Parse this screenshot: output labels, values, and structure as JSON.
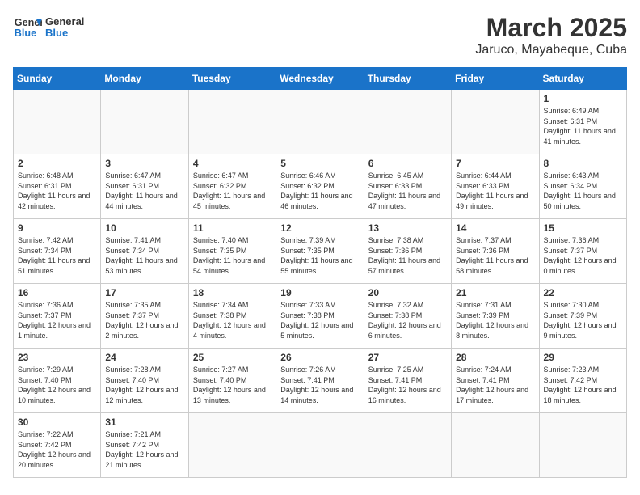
{
  "header": {
    "logo_line1": "General",
    "logo_line2": "Blue",
    "title": "March 2025",
    "subtitle": "Jaruco, Mayabeque, Cuba"
  },
  "days_of_week": [
    "Sunday",
    "Monday",
    "Tuesday",
    "Wednesday",
    "Thursday",
    "Friday",
    "Saturday"
  ],
  "weeks": [
    [
      {
        "day": "",
        "info": ""
      },
      {
        "day": "",
        "info": ""
      },
      {
        "day": "",
        "info": ""
      },
      {
        "day": "",
        "info": ""
      },
      {
        "day": "",
        "info": ""
      },
      {
        "day": "",
        "info": ""
      },
      {
        "day": "1",
        "info": "Sunrise: 6:49 AM\nSunset: 6:31 PM\nDaylight: 11 hours\nand 41 minutes."
      }
    ],
    [
      {
        "day": "2",
        "info": "Sunrise: 6:48 AM\nSunset: 6:31 PM\nDaylight: 11 hours\nand 42 minutes."
      },
      {
        "day": "3",
        "info": "Sunrise: 6:47 AM\nSunset: 6:31 PM\nDaylight: 11 hours\nand 44 minutes."
      },
      {
        "day": "4",
        "info": "Sunrise: 6:47 AM\nSunset: 6:32 PM\nDaylight: 11 hours\nand 45 minutes."
      },
      {
        "day": "5",
        "info": "Sunrise: 6:46 AM\nSunset: 6:32 PM\nDaylight: 11 hours\nand 46 minutes."
      },
      {
        "day": "6",
        "info": "Sunrise: 6:45 AM\nSunset: 6:33 PM\nDaylight: 11 hours\nand 47 minutes."
      },
      {
        "day": "7",
        "info": "Sunrise: 6:44 AM\nSunset: 6:33 PM\nDaylight: 11 hours\nand 49 minutes."
      },
      {
        "day": "8",
        "info": "Sunrise: 6:43 AM\nSunset: 6:34 PM\nDaylight: 11 hours\nand 50 minutes."
      }
    ],
    [
      {
        "day": "9",
        "info": "Sunrise: 7:42 AM\nSunset: 7:34 PM\nDaylight: 11 hours\nand 51 minutes."
      },
      {
        "day": "10",
        "info": "Sunrise: 7:41 AM\nSunset: 7:34 PM\nDaylight: 11 hours\nand 53 minutes."
      },
      {
        "day": "11",
        "info": "Sunrise: 7:40 AM\nSunset: 7:35 PM\nDaylight: 11 hours\nand 54 minutes."
      },
      {
        "day": "12",
        "info": "Sunrise: 7:39 AM\nSunset: 7:35 PM\nDaylight: 11 hours\nand 55 minutes."
      },
      {
        "day": "13",
        "info": "Sunrise: 7:38 AM\nSunset: 7:36 PM\nDaylight: 11 hours\nand 57 minutes."
      },
      {
        "day": "14",
        "info": "Sunrise: 7:37 AM\nSunset: 7:36 PM\nDaylight: 11 hours\nand 58 minutes."
      },
      {
        "day": "15",
        "info": "Sunrise: 7:36 AM\nSunset: 7:37 PM\nDaylight: 12 hours\nand 0 minutes."
      }
    ],
    [
      {
        "day": "16",
        "info": "Sunrise: 7:36 AM\nSunset: 7:37 PM\nDaylight: 12 hours\nand 1 minute."
      },
      {
        "day": "17",
        "info": "Sunrise: 7:35 AM\nSunset: 7:37 PM\nDaylight: 12 hours\nand 2 minutes."
      },
      {
        "day": "18",
        "info": "Sunrise: 7:34 AM\nSunset: 7:38 PM\nDaylight: 12 hours\nand 4 minutes."
      },
      {
        "day": "19",
        "info": "Sunrise: 7:33 AM\nSunset: 7:38 PM\nDaylight: 12 hours\nand 5 minutes."
      },
      {
        "day": "20",
        "info": "Sunrise: 7:32 AM\nSunset: 7:38 PM\nDaylight: 12 hours\nand 6 minutes."
      },
      {
        "day": "21",
        "info": "Sunrise: 7:31 AM\nSunset: 7:39 PM\nDaylight: 12 hours\nand 8 minutes."
      },
      {
        "day": "22",
        "info": "Sunrise: 7:30 AM\nSunset: 7:39 PM\nDaylight: 12 hours\nand 9 minutes."
      }
    ],
    [
      {
        "day": "23",
        "info": "Sunrise: 7:29 AM\nSunset: 7:40 PM\nDaylight: 12 hours\nand 10 minutes."
      },
      {
        "day": "24",
        "info": "Sunrise: 7:28 AM\nSunset: 7:40 PM\nDaylight: 12 hours\nand 12 minutes."
      },
      {
        "day": "25",
        "info": "Sunrise: 7:27 AM\nSunset: 7:40 PM\nDaylight: 12 hours\nand 13 minutes."
      },
      {
        "day": "26",
        "info": "Sunrise: 7:26 AM\nSunset: 7:41 PM\nDaylight: 12 hours\nand 14 minutes."
      },
      {
        "day": "27",
        "info": "Sunrise: 7:25 AM\nSunset: 7:41 PM\nDaylight: 12 hours\nand 16 minutes."
      },
      {
        "day": "28",
        "info": "Sunrise: 7:24 AM\nSunset: 7:41 PM\nDaylight: 12 hours\nand 17 minutes."
      },
      {
        "day": "29",
        "info": "Sunrise: 7:23 AM\nSunset: 7:42 PM\nDaylight: 12 hours\nand 18 minutes."
      }
    ],
    [
      {
        "day": "30",
        "info": "Sunrise: 7:22 AM\nSunset: 7:42 PM\nDaylight: 12 hours\nand 20 minutes."
      },
      {
        "day": "31",
        "info": "Sunrise: 7:21 AM\nSunset: 7:42 PM\nDaylight: 12 hours\nand 21 minutes."
      },
      {
        "day": "",
        "info": ""
      },
      {
        "day": "",
        "info": ""
      },
      {
        "day": "",
        "info": ""
      },
      {
        "day": "",
        "info": ""
      },
      {
        "day": "",
        "info": ""
      }
    ]
  ]
}
